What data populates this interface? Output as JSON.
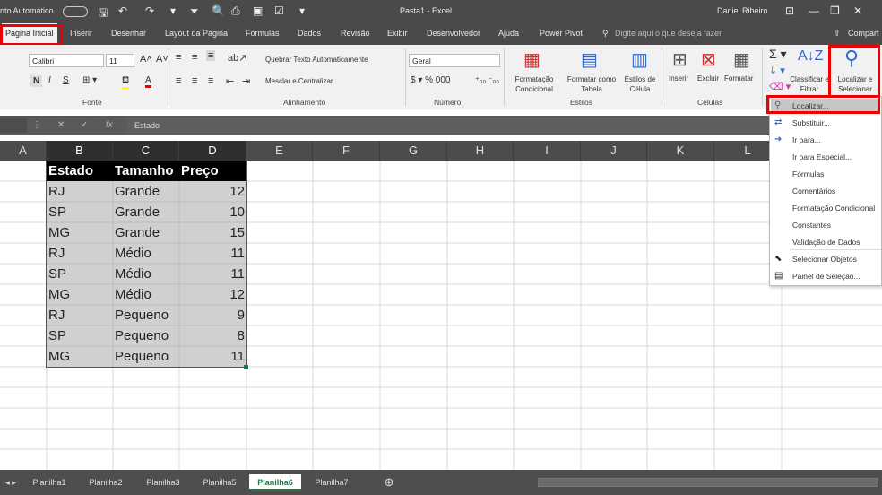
{
  "titlebar": {
    "autosave": "nto Automático",
    "doc_title": "Pasta1  -  Excel",
    "user": "Daniel Ribeiro"
  },
  "tabs": [
    "Página Inicial",
    "Inserir",
    "Desenhar",
    "Layout da Página",
    "Fórmulas",
    "Dados",
    "Revisão",
    "Exibir",
    "Desenvolvedor",
    "Ajuda",
    "Power Pivot"
  ],
  "tellme": "Digite aqui o que deseja fazer",
  "share": "Compart",
  "ribbon": {
    "font_name": "Calibri",
    "font_size": "11",
    "wrap_text": "Quebrar Texto Automaticamente",
    "merge_center": "Mesclar e Centralizar",
    "number_format": "Geral",
    "cond_format": "Formatação Condicional",
    "format_table": "Formatar como Tabela",
    "cell_styles": "Estilos de Célula",
    "insert": "Inserir",
    "delete": "Excluir",
    "format": "Formatar",
    "sort_filter": "Classificar e Filtrar",
    "find_select": "Localizar e Selecionar",
    "groups": {
      "font": "Fonte",
      "alignment": "Alinhamento",
      "number": "Número",
      "styles": "Estilos",
      "cells": "Células"
    }
  },
  "formula_bar": {
    "value": "Estado"
  },
  "columns": [
    "A",
    "B",
    "C",
    "D",
    "E",
    "F",
    "G",
    "H",
    "I",
    "J",
    "K",
    "L"
  ],
  "table": {
    "headers": [
      "Estado",
      "Tamanho",
      "Preço"
    ],
    "rows": [
      [
        "RJ",
        "Grande",
        "12"
      ],
      [
        "SP",
        "Grande",
        "10"
      ],
      [
        "MG",
        "Grande",
        "15"
      ],
      [
        "RJ",
        "Médio",
        "11"
      ],
      [
        "SP",
        "Médio",
        "11"
      ],
      [
        "MG",
        "Médio",
        "12"
      ],
      [
        "RJ",
        "Pequeno",
        "9"
      ],
      [
        "SP",
        "Pequeno",
        "8"
      ],
      [
        "MG",
        "Pequeno",
        "11"
      ]
    ]
  },
  "menu": [
    "Localizar...",
    "Substituir...",
    "Ir para...",
    "Ir para Especial...",
    "Fórmulas",
    "Comentários",
    "Formatação Condicional",
    "Constantes",
    "Validação de Dados",
    "Selecionar Objetos",
    "Painel de Seleção..."
  ],
  "sheets": [
    "Planilha1",
    "Planilha2",
    "Planilha3",
    "Planilha5",
    "Planilha6",
    "Planilha7"
  ],
  "colors": {
    "accent": "#217346",
    "highlight": "#e00000"
  }
}
